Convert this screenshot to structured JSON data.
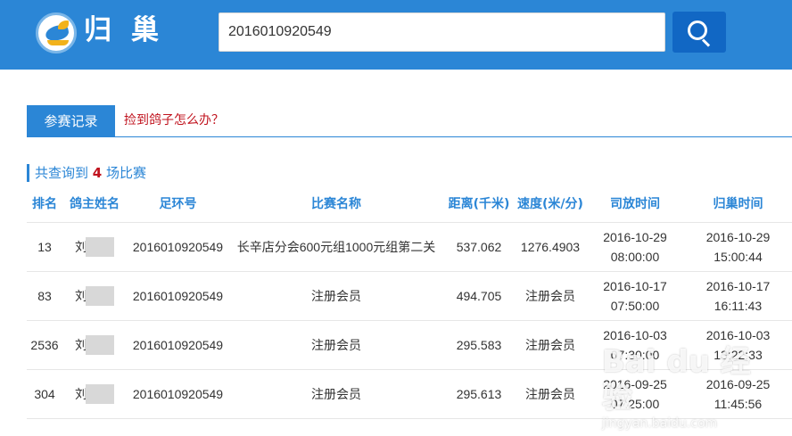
{
  "header": {
    "logo_text": "归巢",
    "search_value": "2016010920549"
  },
  "tabs": {
    "active": "参赛记录",
    "link": "捡到鸽子怎么办？"
  },
  "summary": {
    "prefix": "共查询到",
    "count": "4",
    "suffix": "场比赛"
  },
  "table": {
    "headers": [
      "排名",
      "鸽主姓名",
      "足环号",
      "比赛名称",
      "距离(千米)",
      "速度(米/分)",
      "司放时间",
      "归巢时间"
    ],
    "rows": [
      {
        "rank": "13",
        "owner": "刘",
        "ring": "2016010920549",
        "race": "长辛店分会600元组1000元组第二关",
        "distance": "537.062",
        "speed": "1276.4903",
        "release_date": "2016-10-29",
        "release_time": "08:00:00",
        "return_date": "2016-10-29",
        "return_time": "15:00:44"
      },
      {
        "rank": "83",
        "owner": "刘",
        "ring": "2016010920549",
        "race": "注册会员",
        "distance": "494.705",
        "speed": "注册会员",
        "release_date": "2016-10-17",
        "release_time": "07:50:00",
        "return_date": "2016-10-17",
        "return_time": "16:11:43"
      },
      {
        "rank": "2536",
        "owner": "刘",
        "ring": "2016010920549",
        "race": "注册会员",
        "distance": "295.583",
        "speed": "注册会员",
        "release_date": "2016-10-03",
        "release_time": "07:30:00",
        "return_date": "2016-10-03",
        "return_time": "13:22:33"
      },
      {
        "rank": "304",
        "owner": "刘",
        "ring": "2016010920549",
        "race": "注册会员",
        "distance": "295.613",
        "speed": "注册会员",
        "release_date": "2016-09-25",
        "release_time": "07:25:00",
        "return_date": "2016-09-25",
        "return_time": "11:45:56"
      }
    ]
  },
  "watermark": {
    "text": "Bai du 经验",
    "sub": "jingyan.baidu.com"
  },
  "colors": {
    "brand_blue": "#2b86d6",
    "button_blue": "#1167c4",
    "ring_red": "#c0121d"
  }
}
